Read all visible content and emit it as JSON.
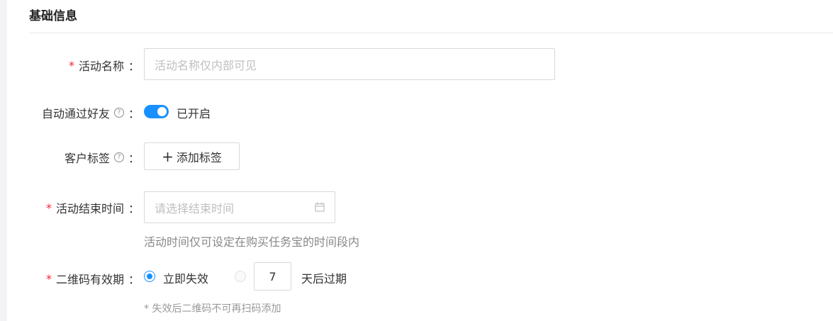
{
  "section": {
    "title": "基础信息"
  },
  "fields": {
    "activity_name": {
      "required_mark": "*",
      "label": "活动名称",
      "colon": "：",
      "placeholder": "活动名称仅内部可见"
    },
    "auto_accept": {
      "label": "自动通过好友",
      "help": "?",
      "colon": "：",
      "status": "已开启",
      "enabled": true
    },
    "customer_tags": {
      "label": "客户标签",
      "help": "?",
      "colon": "：",
      "button": "添加标签",
      "button_icon": "+"
    },
    "end_time": {
      "required_mark": "*",
      "label": "活动结束时间",
      "colon": "：",
      "placeholder": "请选择结束时间",
      "hint": "活动时间仅可设定在购买任务宝的时间段内"
    },
    "qr_validity": {
      "required_mark": "*",
      "label": "二维码有效期",
      "colon": "：",
      "option_immediate": "立即失效",
      "days_value": "7",
      "option_days_suffix": "天后过期",
      "selected": "immediate",
      "hint": "* 失效后二维码不可再扫码添加"
    }
  },
  "colors": {
    "accent": "#1890ff",
    "required": "#f5222d"
  }
}
